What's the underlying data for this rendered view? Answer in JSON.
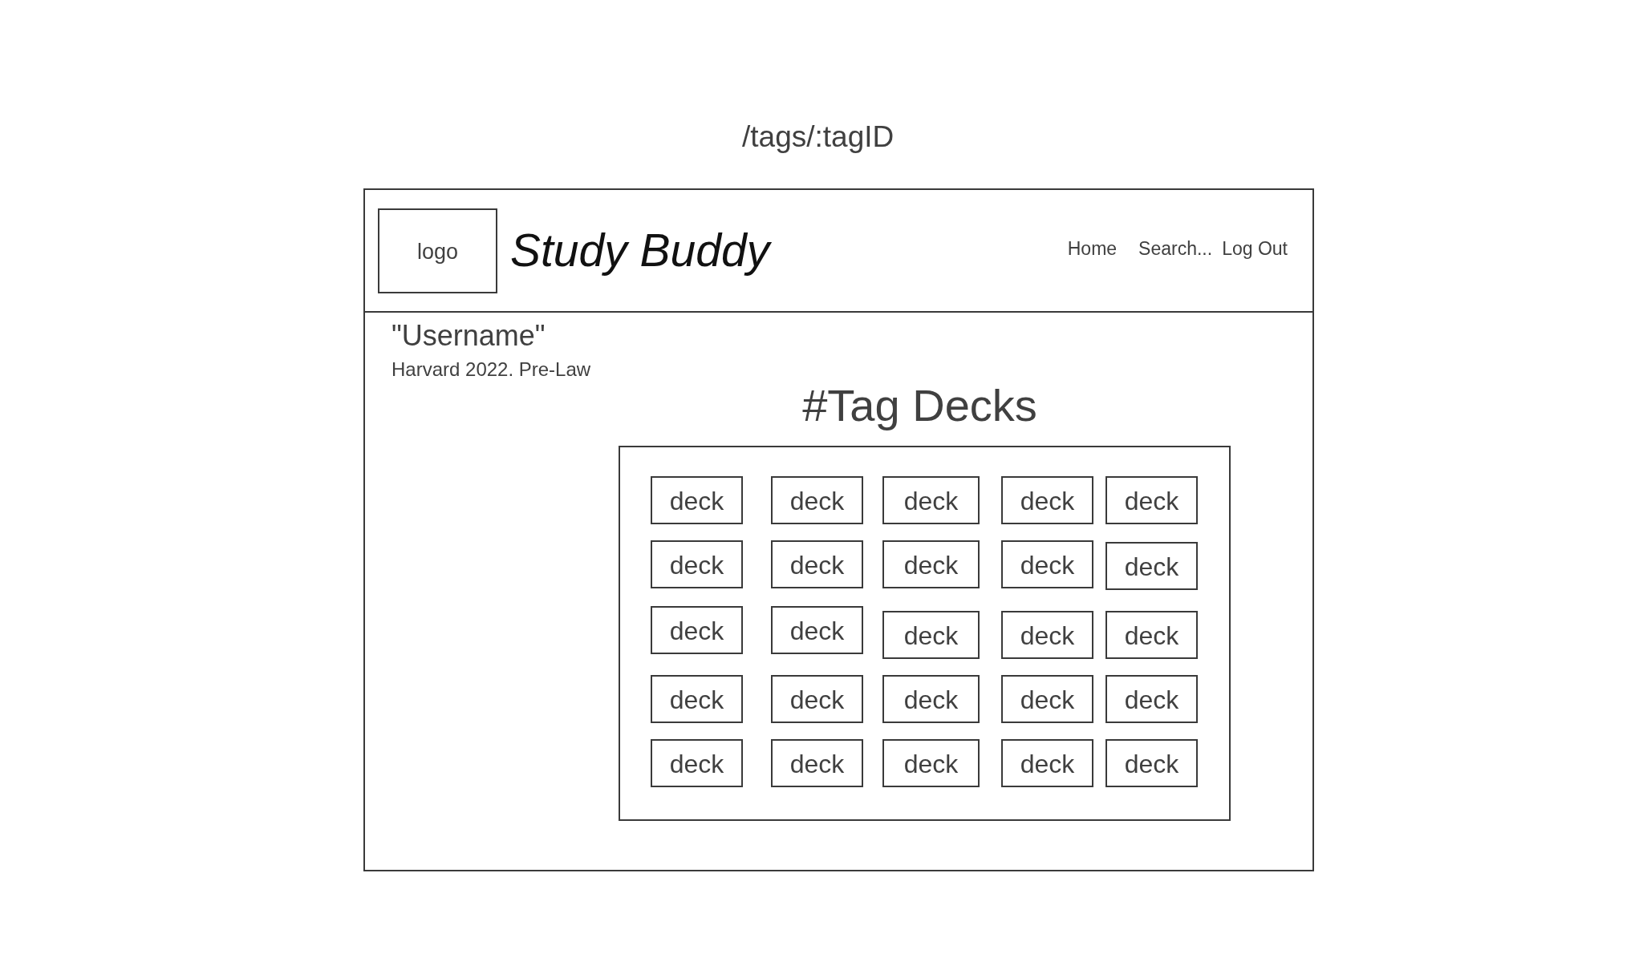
{
  "page_title": "/tags/:tagID",
  "header": {
    "logo": "logo",
    "app_name": "Study Buddy",
    "nav": [
      "Home",
      "Search...",
      "Log Out"
    ]
  },
  "profile": {
    "username": "\"Username\"",
    "details": "Harvard 2022. Pre-Law"
  },
  "decks_section": {
    "heading": "#Tag Decks",
    "decks": [
      "deck",
      "deck",
      "deck",
      "deck",
      "deck",
      "deck",
      "deck",
      "deck",
      "deck",
      "deck",
      "deck",
      "deck",
      "deck",
      "deck",
      "deck",
      "deck",
      "deck",
      "deck",
      "deck",
      "deck",
      "deck",
      "deck",
      "deck",
      "deck",
      "deck"
    ]
  }
}
